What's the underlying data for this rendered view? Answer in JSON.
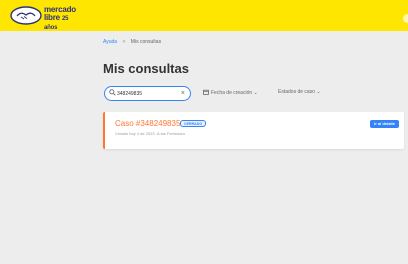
{
  "header": {
    "logo_text": "mercado",
    "logo_text_line2": "libre",
    "logo_suffix": "25 años",
    "accent": "#ffe600",
    "brand_blue": "#2d3277"
  },
  "breadcrumb": {
    "root": "Ayuda",
    "separator": ">",
    "current": "Mis consultas"
  },
  "page": {
    "title": "Mis consultas"
  },
  "search": {
    "value": "348249835",
    "icon": "search-icon",
    "clear_icon": "close-icon"
  },
  "filters": {
    "date_label": "Fecha de creación",
    "state_label": "Estados de caso"
  },
  "case": {
    "title": "Caso #348249835",
    "status": "CERRADO",
    "subtitle": "Creado hoy 4 de 2023 ·A las Formularo",
    "button": "Ir al detalle",
    "accent": "#ff7733",
    "link_color": "#3483fa"
  }
}
